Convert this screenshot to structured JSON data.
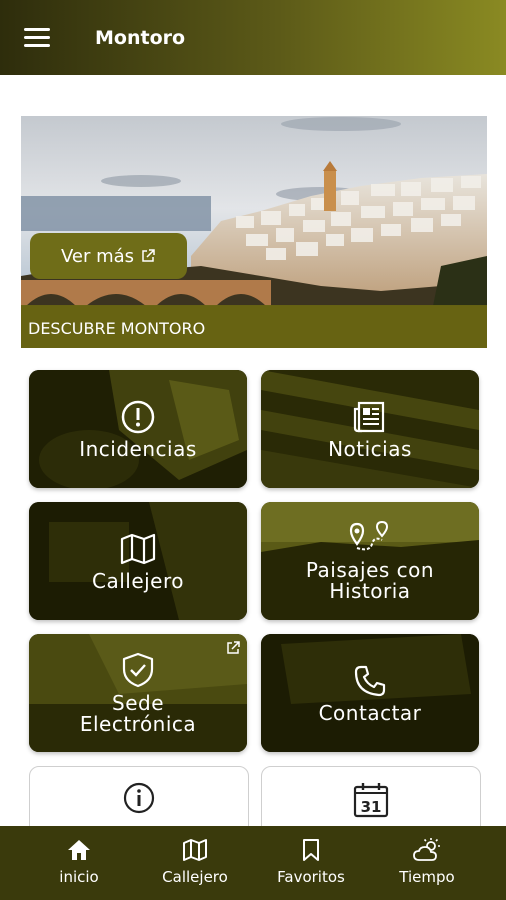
{
  "app_bar": {
    "title": "Montoro",
    "menu_icon": "hamburger-menu-icon"
  },
  "hero": {
    "button_label": "Ver más",
    "caption": "DESCUBRE MONTORO"
  },
  "tiles": [
    {
      "label": "Incidencias",
      "icon": "alert-circle-icon"
    },
    {
      "label": "Noticias",
      "icon": "newspaper-icon"
    },
    {
      "label": "Callejero",
      "icon": "map-icon"
    },
    {
      "label": "Paisajes con Historia",
      "icon": "route-pin-icon"
    },
    {
      "label": "Sede Electrónica",
      "icon": "shield-check-icon"
    },
    {
      "label": "Contactar",
      "icon": "phone-icon"
    },
    {
      "label": "",
      "icon": "info-icon"
    },
    {
      "label": "",
      "icon": "calendar-icon",
      "icon_text": "31"
    }
  ],
  "bottom_nav": [
    {
      "label": "inicio",
      "icon": "home-icon"
    },
    {
      "label": "Callejero",
      "icon": "map-icon"
    },
    {
      "label": "Favoritos",
      "icon": "bookmark-icon"
    },
    {
      "label": "Tiempo",
      "icon": "weather-icon"
    }
  ],
  "colors": {
    "app_bar_dark": "#2e2d0c",
    "app_bar_light": "#8a8a22",
    "accent": "#6f6d18",
    "bottom_nav": "#3a3a0c"
  }
}
